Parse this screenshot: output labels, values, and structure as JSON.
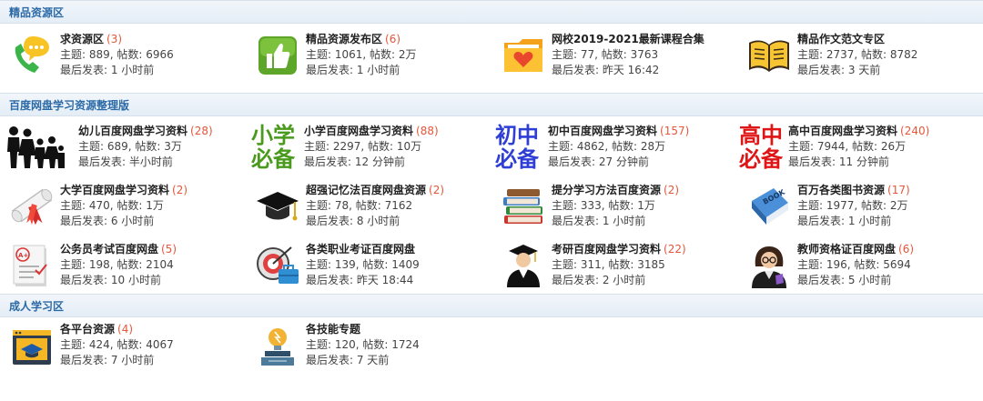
{
  "sections": [
    {
      "title": "精品资源区",
      "forums": [
        {
          "name": "求资源区",
          "count": "(3)",
          "meta1": "主题: 889, 帖数: 6966",
          "meta2": "最后发表: 1 小时前",
          "icon": "phone-chat-icon"
        },
        {
          "name": "精品资源发布区",
          "count": "(6)",
          "meta1": "主题: 1061, 帖数: 2万",
          "meta2": "最后发表: 1 小时前",
          "icon": "thumbs-up-icon"
        },
        {
          "name": "网校2019-2021最新课程合集",
          "count": "",
          "meta1": "主题: 77, 帖数: 3763",
          "meta2": "最后发表: 昨天 16:42",
          "icon": "folder-heart-icon"
        },
        {
          "name": "精品作文范文专区",
          "count": "",
          "meta1": "主题: 2737, 帖数: 8782",
          "meta2": "最后发表: 3 天前",
          "icon": "open-book-icon"
        }
      ]
    },
    {
      "title": "百度网盘学习资源整理版",
      "forums": [
        {
          "name": "幼儿百度网盘学习资料",
          "count": "(28)",
          "meta1": "主题: 689, 帖数: 3万",
          "meta2": "最后发表: 半小时前",
          "icon": "family-icon"
        },
        {
          "name": "小学百度网盘学习资料",
          "count": "(88)",
          "meta1": "主题: 2297, 帖数: 10万",
          "meta2": "最后发表: 12 分钟前",
          "icon": "primary-school-icon",
          "icon_text": [
            "小学",
            "必备"
          ],
          "icon_color": "#4a9a1e"
        },
        {
          "name": "初中百度网盘学习资料",
          "count": "(157)",
          "meta1": "主题: 4862, 帖数: 28万",
          "meta2": "最后发表: 27 分钟前",
          "icon": "middle-school-icon",
          "icon_text": [
            "初中",
            "必备"
          ],
          "icon_color": "#2f3fd6"
        },
        {
          "name": "高中百度网盘学习资料",
          "count": "(240)",
          "meta1": "主题: 7944, 帖数: 26万",
          "meta2": "最后发表: 11 分钟前",
          "icon": "high-school-icon",
          "icon_text": [
            "高中",
            "必备"
          ],
          "icon_color": "#e01616"
        },
        {
          "name": "大学百度网盘学习资料",
          "count": "(2)",
          "meta1": "主题: 470, 帖数: 1万",
          "meta2": "最后发表: 6 小时前",
          "icon": "diploma-icon"
        },
        {
          "name": "超强记忆法百度网盘资源",
          "count": "(2)",
          "meta1": "主题: 78, 帖数: 7162",
          "meta2": "最后发表: 8 小时前",
          "icon": "graduation-cap-icon"
        },
        {
          "name": "提分学习方法百度资源",
          "count": "(2)",
          "meta1": "主题: 333, 帖数: 1万",
          "meta2": "最后发表: 1 小时前",
          "icon": "book-stack-icon"
        },
        {
          "name": "百万各类图书资源",
          "count": "(17)",
          "meta1": "主题: 1977, 帖数: 2万",
          "meta2": "最后发表: 1 小时前",
          "icon": "blue-book-icon",
          "icon_label": "BOOK"
        },
        {
          "name": "公务员考试百度网盘",
          "count": "(5)",
          "meta1": "主题: 198, 帖数: 2104",
          "meta2": "最后发表: 10 小时前",
          "icon": "exam-paper-icon",
          "icon_label": "A+"
        },
        {
          "name": "各类职业考证百度网盘",
          "count": "",
          "meta1": "主题: 139, 帖数: 1409",
          "meta2": "最后发表: 昨天 18:44",
          "icon": "target-briefcase-icon"
        },
        {
          "name": "考研百度网盘学习资料",
          "count": "(22)",
          "meta1": "主题: 311, 帖数: 3185",
          "meta2": "最后发表: 2 小时前",
          "icon": "graduate-icon"
        },
        {
          "name": "教师资格证百度网盘",
          "count": "(6)",
          "meta1": "主题: 196, 帖数: 5694",
          "meta2": "最后发表: 5 小时前",
          "icon": "teacher-icon"
        }
      ]
    },
    {
      "title": "成人学习区",
      "forums": [
        {
          "name": "各平台资源",
          "count": "(4)",
          "meta1": "主题: 424, 帖数: 4067",
          "meta2": "最后发表: 7 小时前",
          "icon": "online-course-icon"
        },
        {
          "name": "各技能专题",
          "count": "",
          "meta1": "主题: 120, 帖数: 1724",
          "meta2": "最后发表: 7 天前",
          "icon": "idea-lightbulb-icon"
        }
      ]
    }
  ]
}
